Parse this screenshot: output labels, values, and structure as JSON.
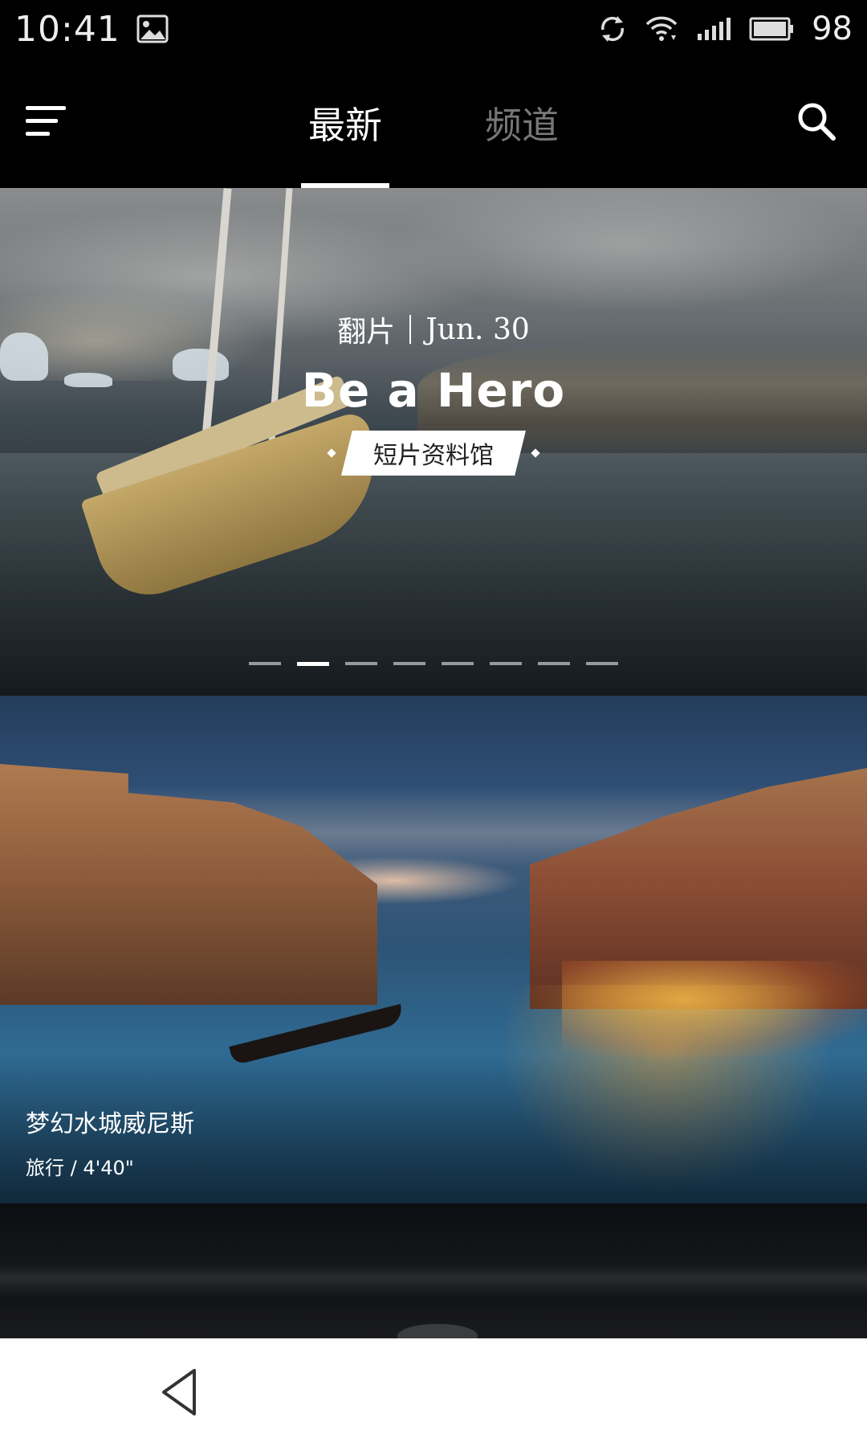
{
  "status_bar": {
    "time": "10:41",
    "battery": "98",
    "icons": [
      "image-icon",
      "sync-icon",
      "wifi-icon",
      "signal-icon",
      "battery-icon"
    ]
  },
  "header": {
    "tabs": [
      {
        "label": "最新",
        "active": true
      },
      {
        "label": "频道",
        "active": false
      }
    ],
    "icons": [
      "menu-icon",
      "search-icon"
    ]
  },
  "hero": {
    "brand": "翻片",
    "date": "Jun. 30",
    "title": "Be a Hero",
    "tag": "短片资料馆",
    "pager_count": 8,
    "pager_active_index": 1
  },
  "video_card": {
    "title": "梦幻水城威尼斯",
    "meta": "旅行 / 4'40\""
  },
  "nav_bar": {
    "icons": [
      "back-icon"
    ]
  },
  "colors": {
    "background": "#000000",
    "tab_active": "#ffffff",
    "tab_inactive": "#777777",
    "nav_bar": "#ffffff"
  }
}
